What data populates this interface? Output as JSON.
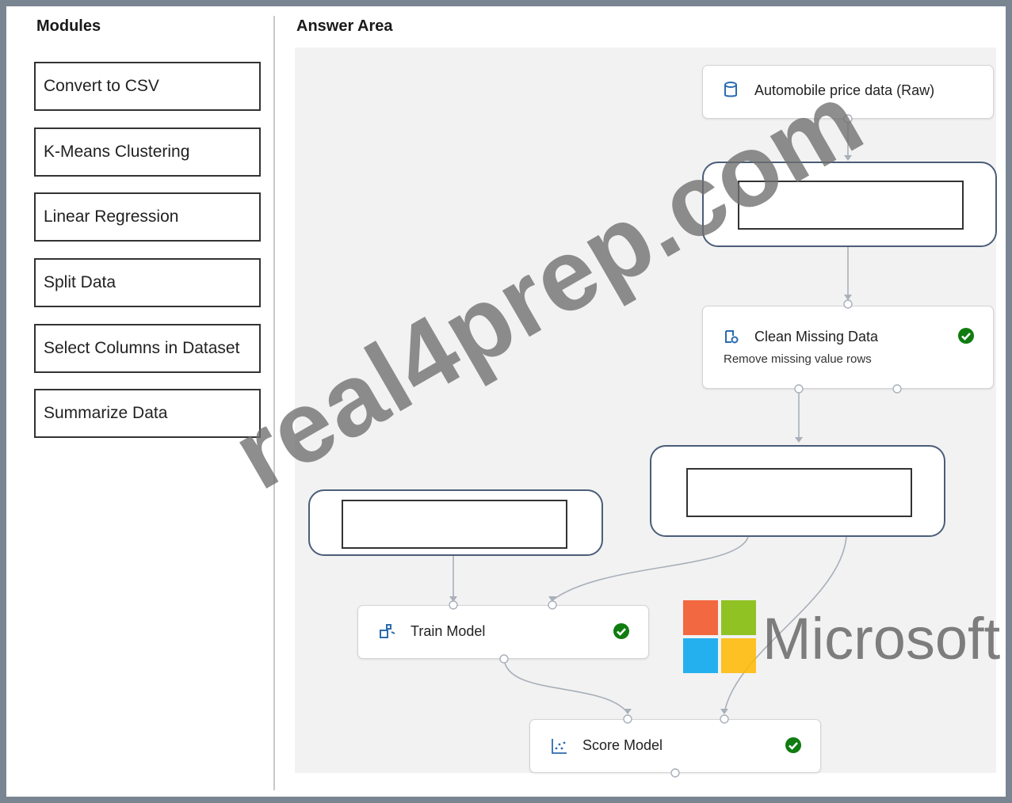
{
  "modules": {
    "title": "Modules",
    "items": [
      "Convert to CSV",
      "K-Means Clustering",
      "Linear Regression",
      "Split Data",
      "Select Columns in Dataset",
      "Summarize Data"
    ]
  },
  "answer_area": {
    "title": "Answer Area",
    "nodes": {
      "dataset": {
        "label": "Automobile price data (Raw)",
        "icon": "database-icon"
      },
      "clean": {
        "label": "Clean Missing Data",
        "sub": "Remove missing value rows",
        "icon": "clean-data-icon",
        "status": "success-check-icon"
      },
      "train": {
        "label": "Train Model",
        "icon": "train-model-icon",
        "status": "success-check-icon"
      },
      "score": {
        "label": "Score Model",
        "icon": "score-model-icon",
        "status": "success-check-icon"
      }
    }
  },
  "watermark": {
    "text": "real4prep.com"
  },
  "logo": {
    "text": "Microsoft",
    "colors": [
      "#f25022",
      "#7fba00",
      "#00a4ef",
      "#ffb900"
    ]
  },
  "colors": {
    "check": "#107c10",
    "slot_border": "#4b5d78",
    "icon": "#2b6cb0"
  }
}
